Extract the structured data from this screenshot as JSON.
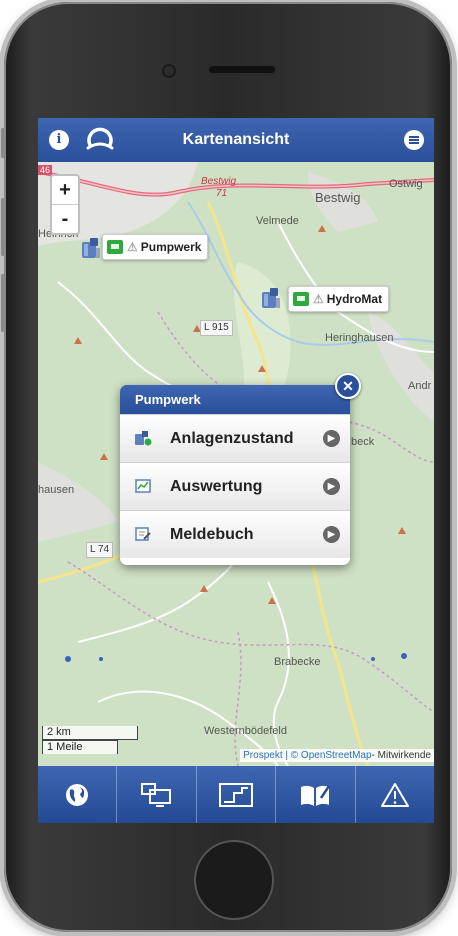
{
  "header": {
    "title": "Kartenansicht",
    "info_label": "i"
  },
  "zoom": {
    "in_label": "+",
    "out_label": "-"
  },
  "map": {
    "places": [
      "Bestwig",
      "Ostwig",
      "Velmede",
      "Heinrich",
      "Heringhausen",
      "Andr",
      "hausen",
      "beck",
      "Brabecke",
      "Westernbödefeld"
    ],
    "road_labels": [
      "L 915",
      "L 74"
    ],
    "highway_label": "Bestwig",
    "highway_number": "71",
    "highway_start": "46"
  },
  "markers": [
    {
      "name": "Pumpwerk",
      "status": "green",
      "warning_icon": "warning-icon"
    },
    {
      "name": "HydroMat",
      "status": "green",
      "warning_icon": "warning-icon"
    }
  ],
  "popup": {
    "title": "Pumpwerk",
    "items": [
      {
        "label": "Anlagenzustand",
        "icon": "plant-status-icon"
      },
      {
        "label": "Auswertung",
        "icon": "chart-icon"
      },
      {
        "label": "Meldebuch",
        "icon": "logbook-icon"
      }
    ]
  },
  "scale": {
    "metric": "2 km",
    "imperial": "1 Meile"
  },
  "attribution": {
    "prefix": "Prospekt | ©",
    "link": "OpenStreetMap",
    "suffix": "- Mitwirkende"
  },
  "tabbar": {
    "tabs": [
      {
        "icon": "globe-icon"
      },
      {
        "icon": "monitor-icon"
      },
      {
        "icon": "diagram-icon"
      },
      {
        "icon": "book-icon"
      },
      {
        "icon": "warning-icon"
      }
    ]
  },
  "colors": {
    "primary": "#2a4f9b",
    "status_ok": "#2eaa3c",
    "map_bg": "#cfe1c4"
  }
}
